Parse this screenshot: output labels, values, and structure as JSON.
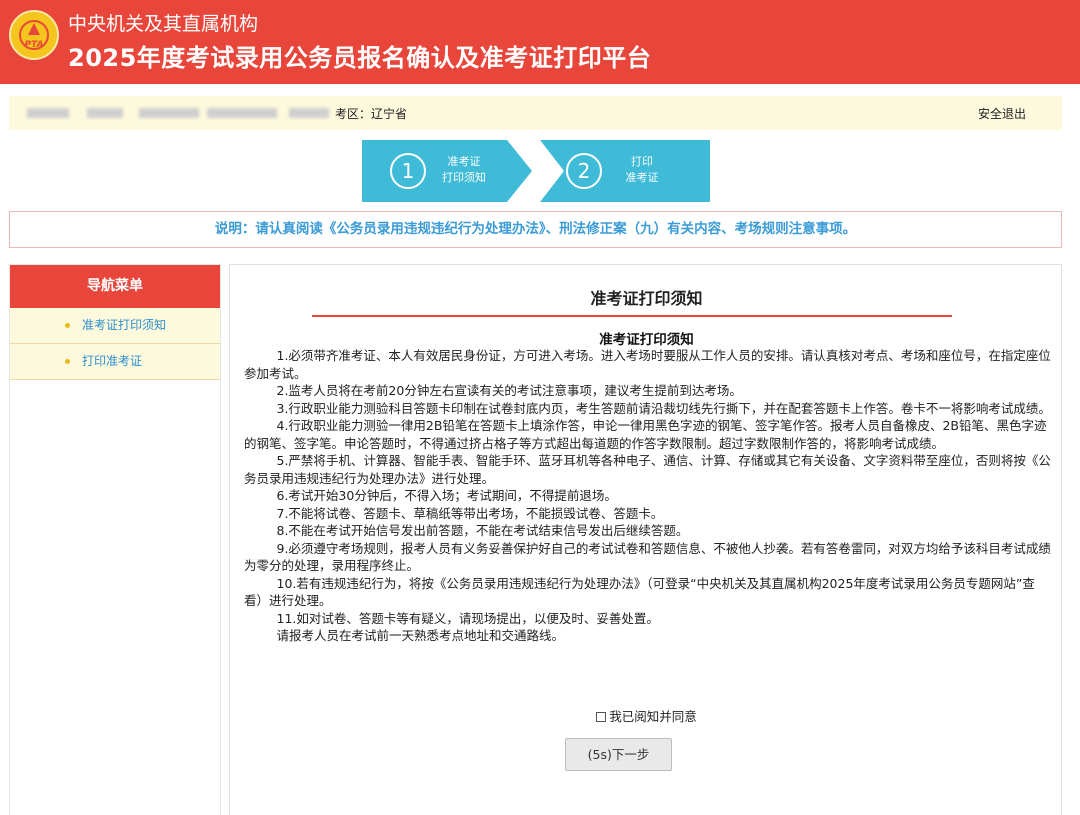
{
  "header": {
    "subtitle": "中央机关及其直属机构",
    "title": "2025年度考试录用公务员报名确认及准考证打印平台",
    "logo_text": "PTA",
    "color": "#e8463a"
  },
  "userbar": {
    "region": "考区：辽宁省",
    "logout": "安全退出"
  },
  "steps": [
    {
      "number": "1",
      "line1": "准考证",
      "line2": "打印须知"
    },
    {
      "number": "2",
      "line1": "打印",
      "line2": "准考证"
    }
  ],
  "notice": "说明：请认真阅读《公务员录用违规违纪行为处理办法》、刑法修正案（九）有关内容、考场规则注意事项。",
  "sidebar": {
    "title": "导航菜单",
    "items": [
      {
        "label": "准考证打印须知"
      },
      {
        "label": "打印准考证"
      }
    ]
  },
  "main": {
    "title": "准考证打印须知",
    "inner_title": "准考证打印须知",
    "rules": [
      "1.必须带齐准考证、本人有效居民身份证，方可进入考场。进入考场时要服从工作人员的安排。请认真核对考点、考场和座位号，在指定座位参加考试。",
      "2.监考人员将在考前20分钟左右宣读有关的考试注意事项，建议考生提前到达考场。",
      "3.行政职业能力测验科目答题卡印制在试卷封底内页，考生答题前请沿裁切线先行撕下，并在配套答题卡上作答。卷卡不一将影响考试成绩。",
      "4.行政职业能力测验一律用2B铅笔在答题卡上填涂作答，申论一律用黑色字迹的钢笔、签字笔作答。报考人员自备橡皮、2B铅笔、黑色字迹的钢笔、签字笔。申论答题时，不得通过挤占格子等方式超出每道题的作答字数限制。超过字数限制作答的，将影响考试成绩。",
      "5.严禁将手机、计算器、智能手表、智能手环、蓝牙耳机等各种电子、通信、计算、存储或其它有关设备、文字资料带至座位，否则将按《公务员录用违规违纪行为处理办法》进行处理。",
      "6.考试开始30分钟后，不得入场；考试期间，不得提前退场。",
      "7.不能将试卷、答题卡、草稿纸等带出考场，不能损毁试卷、答题卡。",
      "8.不能在考试开始信号发出前答题，不能在考试结束信号发出后继续答题。",
      "9.必须遵守考场规则，报考人员有义务妥善保护好自己的考试试卷和答题信息、不被他人抄袭。若有答卷雷同，对双方均给予该科目考试成绩为零分的处理，录用程序终止。",
      "10.若有违规违纪行为，将按《公务员录用违规违纪行为处理办法》（可登录“中央机关及其直属机构2025年度考试录用公务员专题网站”查看）进行处理。",
      "11.如对试卷、答题卡等有疑义，请现场提出，以便及时、妥善处置。",
      "请报考人员在考试前一天熟悉考点地址和交通路线。"
    ],
    "agree_label": "我已阅知并同意",
    "next_label": "(5s)下一步"
  }
}
